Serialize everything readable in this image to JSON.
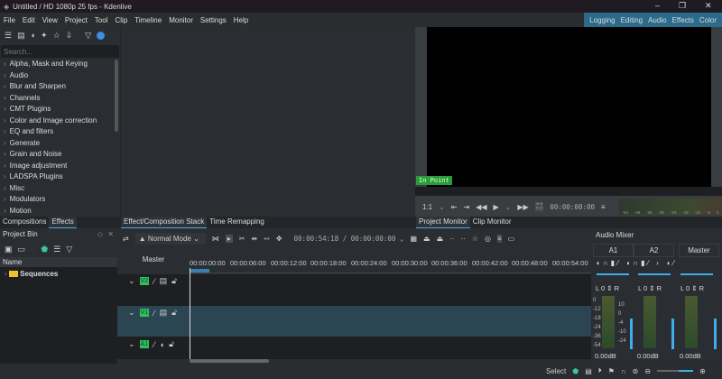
{
  "window": {
    "title": "Untitled / HD 1080p 25 fps - Kdenlive"
  },
  "menu": [
    "File",
    "Edit",
    "View",
    "Project",
    "Tool",
    "Clip",
    "Timeline",
    "Monitor",
    "Settings",
    "Help"
  ],
  "workspaces": [
    "Logging",
    "Editing",
    "Audio",
    "Effects",
    "Color"
  ],
  "effects": {
    "search_placeholder": "Search...",
    "categories": [
      "Alpha, Mask and Keying",
      "Audio",
      "Blur and Sharpen",
      "Channels",
      "CMT Plugins",
      "Color and Image correction",
      "EQ and filters",
      "Generate",
      "Grain and Noise",
      "Image adjustment",
      "LADSPA Plugins",
      "Misc",
      "Modulators",
      "Motion"
    ]
  },
  "left_tabs": [
    "Compositions",
    "Effects"
  ],
  "mid_tabs": [
    "Effect/Composition Stack",
    "Time Remapping"
  ],
  "monitor": {
    "in_point": "In Point",
    "zoom": "1:1",
    "timecode": "00:00:00:00",
    "tabs": [
      "Project Monitor",
      "Clip Monitor"
    ],
    "meter_ticks": [
      "-54",
      "-45",
      "-36",
      "-30",
      "-24",
      "-18",
      "-12",
      "-6",
      "0"
    ]
  },
  "bin": {
    "title": "Project Bin",
    "column": "Name",
    "items": [
      "Sequences"
    ]
  },
  "timeline": {
    "mode": "Normal Mode",
    "position": "00:00:54:18",
    "duration": "00:00:00:00",
    "master": "Master",
    "ruler": [
      "00:00:00:00",
      "00:00:06:00",
      "00:00:12:00",
      "00:00:18:00",
      "00:00:24:00",
      "00:00:30:00",
      "00:00:36:00",
      "00:00:42:00",
      "00:00:48:00",
      "00:00:54:00"
    ],
    "tracks": [
      "V2",
      "V1",
      "A1"
    ]
  },
  "mixer": {
    "title": "Audio Mixer",
    "channels": [
      {
        "name": "A1",
        "pan": "0",
        "gain": "0.00dB"
      },
      {
        "name": "A2",
        "pan": "0",
        "gain": "0.00dB"
      },
      {
        "name": "Master",
        "pan": "0",
        "gain": "0.00dB"
      }
    ],
    "scale_left": [
      "0",
      "-12",
      "-18",
      "-24",
      "-36",
      "-54"
    ],
    "scale_right": [
      "10",
      "0",
      "-4",
      "-10",
      "-24"
    ]
  },
  "status": {
    "tool": "Select"
  }
}
